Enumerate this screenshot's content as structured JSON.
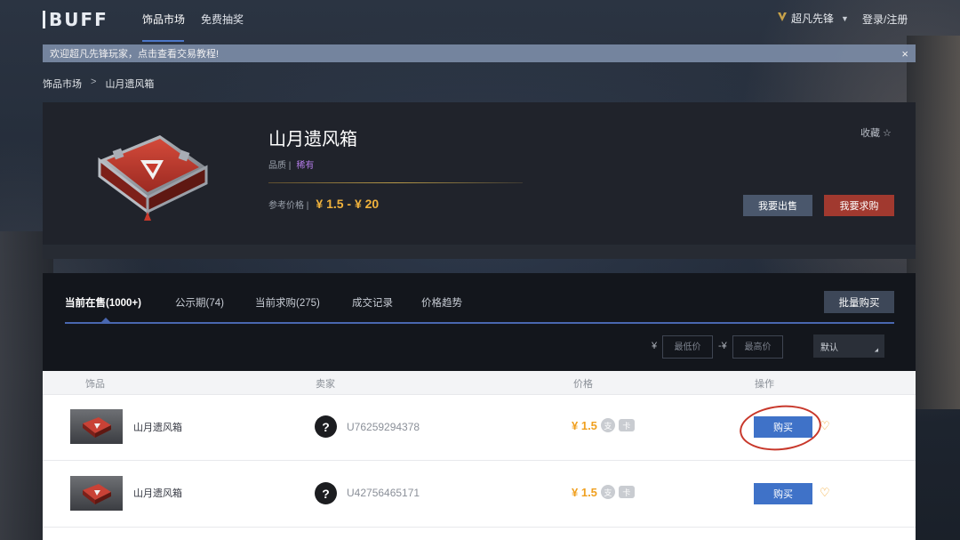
{
  "app": {
    "logo": "BUFF",
    "nav": [
      {
        "label": "饰品市场",
        "active": true
      },
      {
        "label": "免费抽奖",
        "active": false
      }
    ],
    "user": {
      "badge_icon": "v-badge-icon",
      "name": "超凡先锋"
    },
    "login": "登录/注册"
  },
  "notice": {
    "text": "欢迎超凡先锋玩家，点击查看交易教程!",
    "close_glyph": "×"
  },
  "breadcrumb": {
    "items": [
      "饰品市场",
      "山月遗风箱"
    ],
    "separator": ">"
  },
  "item": {
    "title": "山月遗风箱",
    "quality_label": "品质 |",
    "quality_value": "稀有",
    "ref_price_label": "参考价格 |",
    "ref_price_value": "¥ 1.5 - ¥ 20",
    "favorite": "收藏 ☆",
    "sell_button": "我要出售",
    "want_button": "我要求购"
  },
  "tabs": [
    {
      "label": "当前在售(1000+)",
      "active": true
    },
    {
      "label": "公示期(74)",
      "active": false
    },
    {
      "label": "当前求购(275)",
      "active": false
    },
    {
      "label": "成交记录",
      "active": false
    },
    {
      "label": "价格趋势",
      "active": false
    }
  ],
  "bulk_buy": "批量购买",
  "filters": {
    "yen": "¥",
    "dash_yen": "-¥",
    "min_placeholder": "最低价",
    "max_placeholder": "最高价",
    "sort_value": "默认"
  },
  "table": {
    "headers": [
      "饰品",
      "卖家",
      "价格",
      "操作"
    ],
    "rows": [
      {
        "name": "山月遗风箱",
        "seller_icon": "?",
        "seller_id": "U76259294378",
        "price": "¥ 1.5",
        "price_icons": [
          "支",
          "卡"
        ],
        "buy_label": "购买",
        "highlighted": true
      },
      {
        "name": "山月遗风箱",
        "seller_icon": "?",
        "seller_id": "U42756465171",
        "price": "¥ 1.5",
        "price_icons": [
          "支",
          "卡"
        ],
        "buy_label": "购买",
        "highlighted": false
      }
    ]
  },
  "colors": {
    "accent_blue": "#3f72c8",
    "price_gold": "#f0a020",
    "rare_purple": "#b27be6",
    "want_red": "#a1392f",
    "annotation_red": "#c8382b"
  }
}
